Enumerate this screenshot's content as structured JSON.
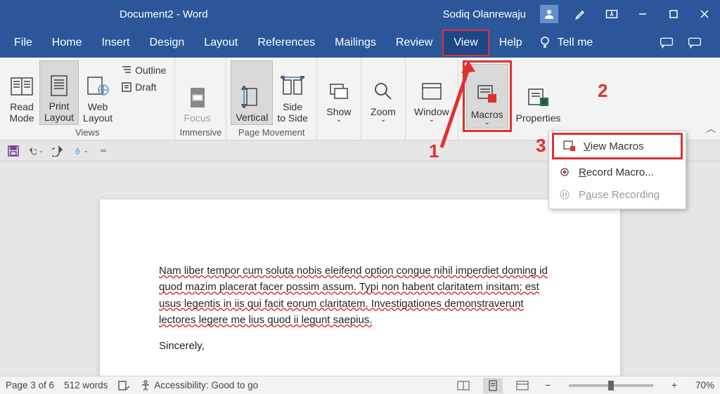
{
  "titlebar": {
    "doc_title": "Document2  -  Word",
    "user_name": "Sodiq Olanrewaju"
  },
  "menu": {
    "items": [
      "File",
      "Home",
      "Insert",
      "Design",
      "Layout",
      "References",
      "Mailings",
      "Review",
      "View",
      "Help"
    ],
    "tell_me": "Tell me"
  },
  "ribbon": {
    "views": {
      "read_mode": "Read Mode",
      "print_layout": "Print Layout",
      "web_layout": "Web Layout",
      "outline": "Outline",
      "draft": "Draft",
      "label": "Views"
    },
    "immersive": {
      "focus": "Focus",
      "label": "Immersive"
    },
    "page_movement": {
      "vertical": "Vertical",
      "side_to_side": "Side to Side",
      "label": "Page Movement"
    },
    "show": "Show",
    "zoom": "Zoom",
    "window": "Window",
    "macros": "Macros",
    "properties": "Properties"
  },
  "dropdown": {
    "view_macros": "View Macros",
    "record_macro": "Record Macro...",
    "pause_recording": "Pause Recording"
  },
  "callouts": {
    "c1": "1",
    "c2": "2",
    "c3": "3"
  },
  "document": {
    "p1": "Nam liber tempor cum soluta nobis eleifend option congue nihil imperdiet doming id quod mazim placerat facer possim assum. Typi non habent claritatem insitam; est usus legentis in iis qui facit eorum claritatem. Investigationes demonstraverunt lectores legere me lius quod ii legunt saepius.",
    "p2": "Sincerely,"
  },
  "status": {
    "page": "Page 3 of 6",
    "words": "512 words",
    "accessibility": "Accessibility: Good to go",
    "zoom": "70%"
  }
}
